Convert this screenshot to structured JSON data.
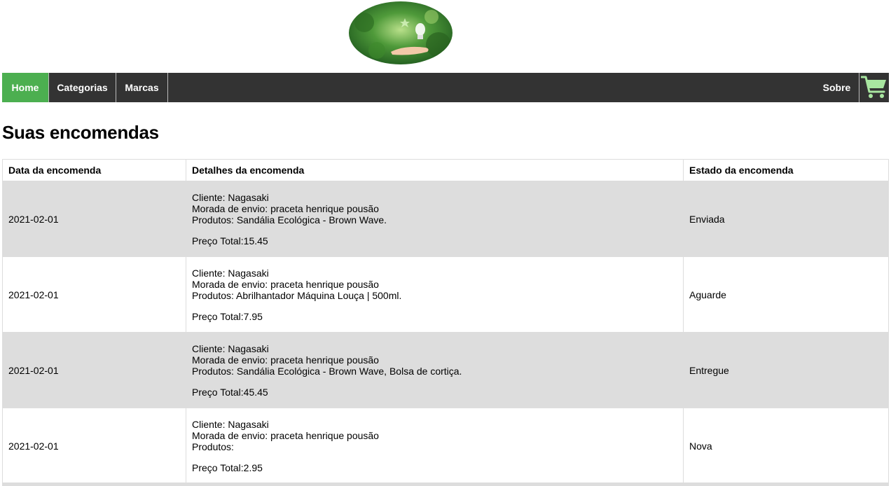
{
  "header": {
    "logo_icon": "lightbulb-in-hand-logo"
  },
  "nav": {
    "items": [
      {
        "label": "Home",
        "active": true
      },
      {
        "label": "Categorias"
      },
      {
        "label": "Marcas"
      }
    ],
    "sobre_label": "Sobre",
    "cart_icon": "shopping-cart-icon",
    "colors": {
      "bar": "#333333",
      "active": "#4caf50",
      "cart": "#a8e6a0"
    }
  },
  "page": {
    "title": "Suas encomendas"
  },
  "table": {
    "headers": [
      "Data da encomenda",
      "Detalhes da encomenda",
      "Estado da encomenda"
    ],
    "rows": [
      {
        "date": "2021-02-01",
        "cliente": "Cliente: Nagasaki",
        "morada": "Morada de envio: praceta henrique pousão",
        "produtos": "Produtos: Sandália Ecológica - Brown Wave.",
        "total": "Preço Total:15.45",
        "estado": "Enviada"
      },
      {
        "date": "2021-02-01",
        "cliente": "Cliente: Nagasaki",
        "morada": "Morada de envio: praceta henrique pousão",
        "produtos": "Produtos: Abrilhantador Máquina Louça | 500ml.",
        "total": "Preço Total:7.95",
        "estado": "Aguarde"
      },
      {
        "date": "2021-02-01",
        "cliente": "Cliente: Nagasaki",
        "morada": "Morada de envio: praceta henrique pousão",
        "produtos": "Produtos: Sandália Ecológica - Brown Wave, Bolsa de cortiça.",
        "total": "Preço Total:45.45",
        "estado": "Entregue"
      },
      {
        "date": "2021-02-01",
        "cliente": "Cliente: Nagasaki",
        "morada": "Morada de envio: praceta henrique pousão",
        "produtos": "Produtos:",
        "total": "Preço Total:2.95",
        "estado": "Nova"
      }
    ]
  }
}
